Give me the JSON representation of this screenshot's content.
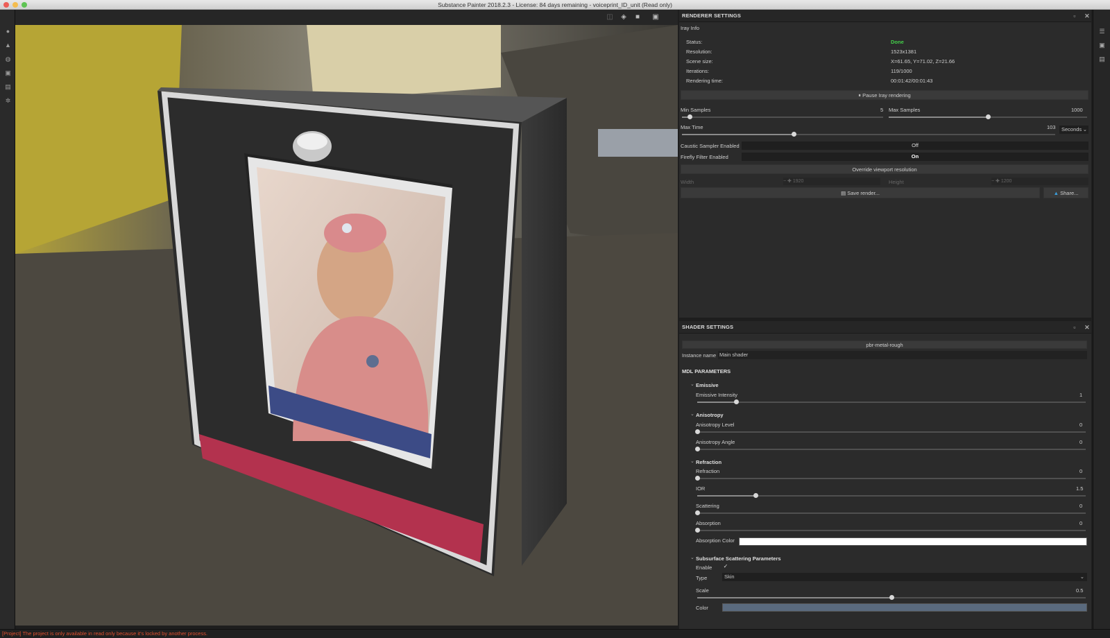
{
  "window": {
    "title": "Substance Painter 2018.2.3 - License: 84 days remaining - voiceprint_ID_unit (Read only)",
    "traffic_colors": [
      "#ed5e57",
      "#f4bd4f",
      "#5fc454"
    ]
  },
  "status_bar": {
    "message": "[Project] The project is only available in read only because it's locked by another process."
  },
  "renderer": {
    "title": "RENDERER SETTINGS",
    "iray_info": "Iray Info",
    "rows": [
      {
        "label": "Status:",
        "value": "Done"
      },
      {
        "label": "Resolution:",
        "value": "1523x1381"
      },
      {
        "label": "Scene size:",
        "value": "X=61.65, Y=71.02, Z=21.66"
      },
      {
        "label": "Iterations:",
        "value": "119/1000"
      },
      {
        "label": "Rendering time:",
        "value": "00:01:42/00:01:43"
      }
    ],
    "status_color": "#44d04a",
    "pause_label": "Pause Iray rendering",
    "min_samples": {
      "label": "Min Samples",
      "value": "5",
      "fraction": 0.04
    },
    "max_samples": {
      "label": "Max Samples",
      "value": "1000",
      "fraction": 0.5
    },
    "max_time": {
      "label": "Max Time",
      "value": "103",
      "fraction": 0.3,
      "unit": "Seconds"
    },
    "caustic": {
      "label": "Caustic Sampler Enabled",
      "value": "Off"
    },
    "firefly": {
      "label": "Firefly Filter Enabled",
      "value": "On"
    },
    "override_label": "Override viewport resolution",
    "width_label": "Width",
    "width_value": "1920",
    "height_label": "Height",
    "height_value": "1200",
    "save_label": "Save render...",
    "share_label": "Share..."
  },
  "shader": {
    "title": "SHADER SETTINGS",
    "shader_name": "pbr-metal-rough",
    "instance_label": "Instance name",
    "instance_value": "Main shader",
    "mdl_title": "MDL PARAMETERS",
    "emissive": {
      "title": "Emissive",
      "params": [
        {
          "label": "Emissive Intensity",
          "value": "1",
          "fraction": 0.1
        }
      ]
    },
    "anisotropy": {
      "title": "Anisotropy",
      "params": [
        {
          "label": "Anisotropy Level",
          "value": "0",
          "fraction": 0.0
        },
        {
          "label": "Anisotropy Angle",
          "value": "0",
          "fraction": 0.0
        }
      ]
    },
    "refraction": {
      "title": "Refraction",
      "params": [
        {
          "label": "Refraction",
          "value": "0",
          "fraction": 0.0
        },
        {
          "label": "IOR",
          "value": "1.5",
          "fraction": 0.15
        },
        {
          "label": "Scattering",
          "value": "0",
          "fraction": 0.0
        },
        {
          "label": "Absorption",
          "value": "0",
          "fraction": 0.0
        }
      ],
      "absorption_color_label": "Absorption Color",
      "absorption_color": "#ffffff"
    },
    "sss": {
      "title": "Subsurface Scattering Parameters",
      "enable_label": "Enable",
      "enable_check": "✓",
      "type_label": "Type",
      "type_value": "Skin",
      "scale_label": "Scale",
      "scale_value": "0.5",
      "scale_fraction": 0.5,
      "color_label": "Color",
      "color_value": "#5a6a7e"
    }
  }
}
